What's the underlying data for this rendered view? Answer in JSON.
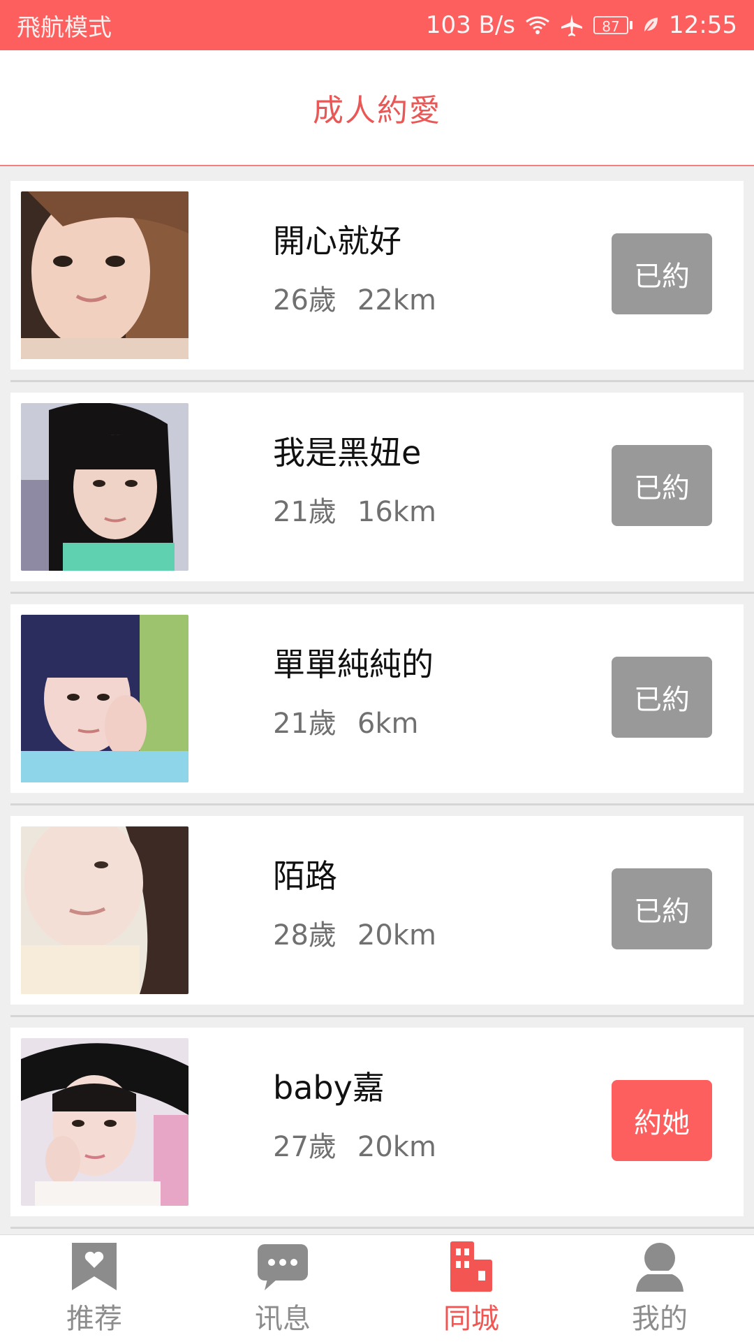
{
  "status_bar": {
    "mode": "飛航模式",
    "speed": "103 B/s",
    "battery": "87",
    "time": "12:55",
    "icons": [
      "wifi-icon",
      "airplane-icon",
      "battery-icon",
      "leaf-icon"
    ]
  },
  "header": {
    "title": "成人約愛"
  },
  "users": [
    {
      "name": "開心就好",
      "age": "26歲",
      "distance": "22km",
      "button": "已約",
      "state": "done"
    },
    {
      "name": "我是黑妞e",
      "age": "21歲",
      "distance": "16km",
      "button": "已約",
      "state": "done"
    },
    {
      "name": "單單純純的",
      "age": "21歲",
      "distance": "6km",
      "button": "已約",
      "state": "done"
    },
    {
      "name": "陌路",
      "age": "28歲",
      "distance": "20km",
      "button": "已約",
      "state": "done"
    },
    {
      "name": "baby嘉",
      "age": "27歲",
      "distance": "20km",
      "button": "約她",
      "state": "active"
    }
  ],
  "tabs": [
    {
      "label": "推荐",
      "icon": "heart-bookmark-icon",
      "active": false
    },
    {
      "label": "讯息",
      "icon": "chat-bubble-icon",
      "active": false
    },
    {
      "label": "同城",
      "icon": "city-building-icon",
      "active": true
    },
    {
      "label": "我的",
      "icon": "person-icon",
      "active": false
    }
  ],
  "colors": {
    "accent": "#fc5f5e",
    "title": "#e95856",
    "done_button": "#999999",
    "active_button": "#fc5f5e",
    "tab_inactive": "#8c8c8c",
    "tab_active": "#f25552"
  }
}
